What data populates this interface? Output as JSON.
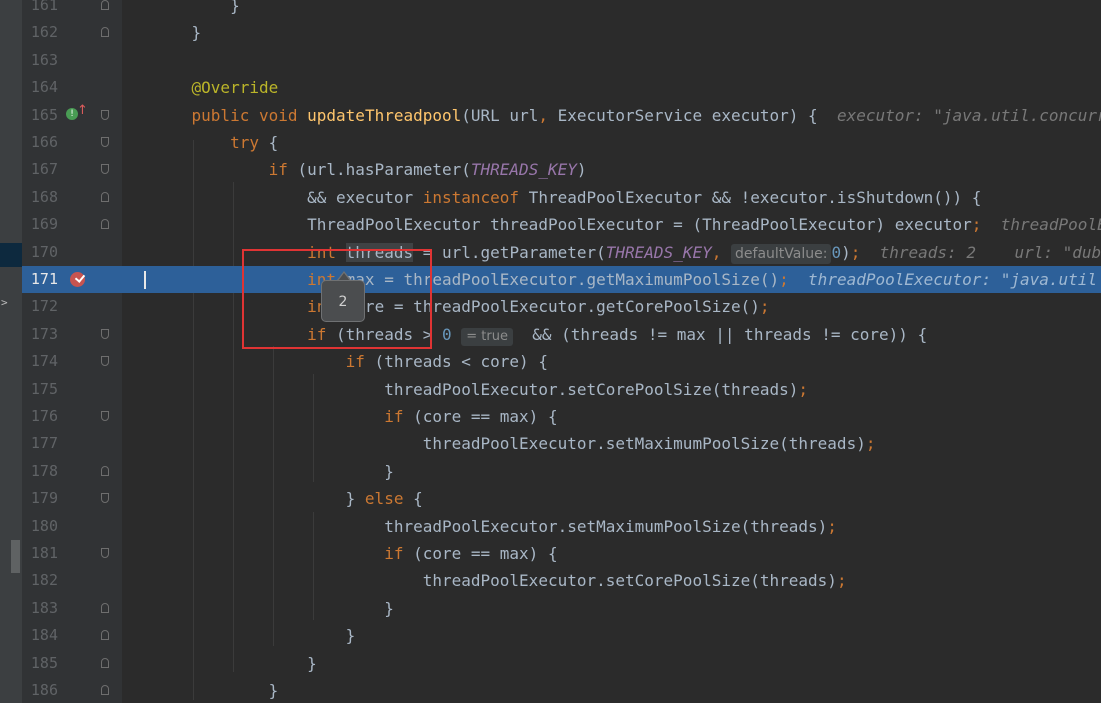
{
  "editor": {
    "lines": [
      {
        "number": "161",
        "fold": "close",
        "text": "        }"
      },
      {
        "number": "162",
        "fold": "close",
        "text": "    }"
      },
      {
        "number": "163",
        "fold": "",
        "text": ""
      },
      {
        "number": "164",
        "fold": "",
        "text": "    @Override"
      },
      {
        "number": "165",
        "fold": "open",
        "text": "    public void updateThreadpool(URL url, ExecutorService executor) {   executor: \"java.util.concurrent"
      },
      {
        "number": "166",
        "fold": "open",
        "text": "        try {"
      },
      {
        "number": "167",
        "fold": "open",
        "text": "            if (url.hasParameter(THREADS_KEY)"
      },
      {
        "number": "168",
        "fold": "close",
        "text": "                && executor instanceof ThreadPoolExecutor && !executor.isShutdown()) {"
      },
      {
        "number": "169",
        "fold": "close",
        "text": "                ThreadPoolExecutor threadPoolExecutor = (ThreadPoolExecutor) executor;   threadPoolExecutor"
      },
      {
        "number": "170",
        "fold": "",
        "text": "                int threads = url.getParameter(THREADS_KEY,  defaultValue: 0);   threads: 2    url: \"dubbo"
      },
      {
        "number": "171",
        "fold": "",
        "text": "                int max = threadPoolExecutor.getMaximumPoolSize();   threadPoolExecutor: \"java.util"
      },
      {
        "number": "172",
        "fold": "",
        "text": "                int core = threadPoolExecutor.getCorePoolSize();"
      },
      {
        "number": "173",
        "fold": "open",
        "text": "                if (threads > 0 = true  && (threads != max || threads != core)) {"
      },
      {
        "number": "174",
        "fold": "open",
        "text": "                    if (threads < core) {"
      },
      {
        "number": "175",
        "fold": "",
        "text": "                        threadPoolExecutor.setCorePoolSize(threads);"
      },
      {
        "number": "176",
        "fold": "open",
        "text": "                        if (core == max) {"
      },
      {
        "number": "177",
        "fold": "",
        "text": "                            threadPoolExecutor.setMaximumPoolSize(threads);"
      },
      {
        "number": "178",
        "fold": "close",
        "text": "                        }"
      },
      {
        "number": "179",
        "fold": "open",
        "text": "                    } else {"
      },
      {
        "number": "180",
        "fold": "",
        "text": "                        threadPoolExecutor.setMaximumPoolSize(threads);"
      },
      {
        "number": "181",
        "fold": "open",
        "text": "                        if (core == max) {"
      },
      {
        "number": "182",
        "fold": "",
        "text": "                            threadPoolExecutor.setCorePoolSize(threads);"
      },
      {
        "number": "183",
        "fold": "close",
        "text": "                        }"
      },
      {
        "number": "184",
        "fold": "close",
        "text": "                    }"
      },
      {
        "number": "185",
        "fold": "close",
        "text": "                }"
      },
      {
        "number": "186",
        "fold": "close",
        "text": "            }"
      }
    ],
    "current_line": "171",
    "breakpoint_line": "171",
    "override_line": "165"
  },
  "gutter_icons": {
    "override_icon": "override-implementing-icon",
    "override_glyph": "!",
    "up_arrow_glyph": "↑",
    "breakpoint_icon": "breakpoint-verified-icon"
  },
  "tokens": {
    "l161": {
      "brace": "}"
    },
    "l162": {
      "brace": "}"
    },
    "l164": {
      "annotation": "@Override"
    },
    "l165": {
      "kw1": "public",
      "kw2": "void",
      "method": "updateThreadpool",
      "rest1": "(URL url",
      "comma": ",",
      "rest2": " ExecutorService executor) {",
      "hint": "executor: \"java.util.concurrent"
    },
    "l166": {
      "kw": "try",
      "rest": " {"
    },
    "l167": {
      "kw": "if",
      "rest1": " (url.hasParameter(",
      "konst": "THREADS_KEY",
      "rest2": ")"
    },
    "l168": {
      "rest1": "&& executor ",
      "kw": "instanceof",
      "rest2": " ThreadPoolExecutor && !executor.isShutdown()) {"
    },
    "l169": {
      "rest": "ThreadPoolExecutor threadPoolExecutor = (ThreadPoolExecutor) executor",
      "semi": ";",
      "hint": "threadPoolExecutor"
    },
    "l170": {
      "kw": "int",
      "ident": "threads",
      "rest1": " = url.getParameter(",
      "konst": "THREADS_KEY",
      "comma": ",",
      "param_hint": "defaultValue:",
      "num": "0",
      "rest2": ")",
      "semi": ";",
      "hint1": "threads: 2",
      "hint2": "url: \"dubbo"
    },
    "l171": {
      "kw": "int",
      "rest": " max = threadPoolExecutor.getMaximumPoolSize()",
      "semi": ";",
      "hint": "threadPoolExecutor: \"java.util"
    },
    "l172": {
      "kw": "int",
      "rest": " core = threadPoolExecutor.getCorePoolSize()",
      "semi": ";"
    },
    "l173": {
      "kw": "if",
      "rest1": " (threads > ",
      "num": "0",
      "true_hint": "= true",
      "rest2": " && (threads != max || threads != core)) {"
    },
    "l174": {
      "kw": "if",
      "rest": " (threads < core) {"
    },
    "l175": {
      "rest": "threadPoolExecutor.setCorePoolSize(threads)",
      "semi": ";"
    },
    "l176": {
      "kw": "if",
      "rest": " (core == max) {"
    },
    "l177": {
      "rest": "threadPoolExecutor.setMaximumPoolSize(threads)",
      "semi": ";"
    },
    "l178": {
      "brace": "}"
    },
    "l179": {
      "brace": "} ",
      "kw": "else",
      "rest": " {"
    },
    "l180": {
      "rest": "threadPoolExecutor.setMaximumPoolSize(threads)",
      "semi": ";"
    },
    "l181": {
      "kw": "if",
      "rest": " (core == max) {"
    },
    "l182": {
      "rest": "threadPoolExecutor.setCorePoolSize(threads)",
      "semi": ";"
    },
    "l183": {
      "brace": "}"
    },
    "l184": {
      "brace": "}"
    },
    "l185": {
      "brace": "}"
    },
    "l186": {
      "brace": "}"
    }
  },
  "tooltip": {
    "value": "2"
  },
  "colors": {
    "background": "#2b2b2b",
    "gutter": "#313335",
    "current_line": "#2d6099",
    "keyword": "#cc7832",
    "method": "#ffc66d",
    "constant": "#9876aa",
    "number": "#6897bb",
    "annotation": "#bbb529",
    "annotation_box": "#e03434"
  }
}
